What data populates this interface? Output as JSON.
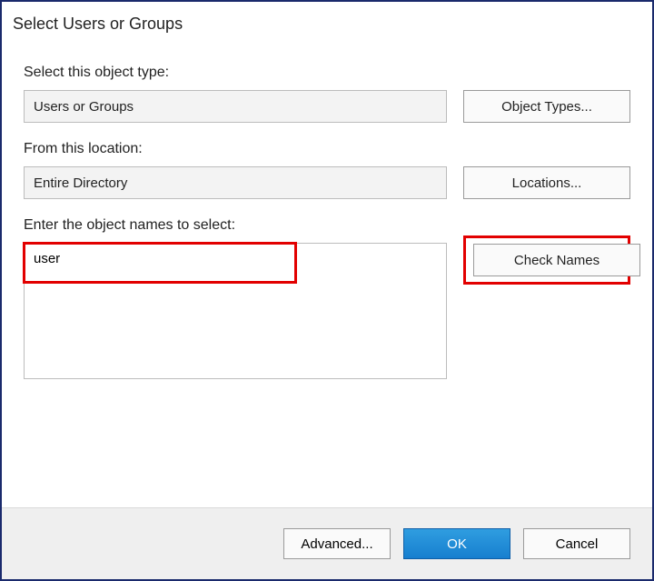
{
  "title": "Select Users or Groups",
  "objectType": {
    "label": "Select this object type:",
    "value": "Users or Groups",
    "button": "Object Types..."
  },
  "location": {
    "label": "From this location:",
    "value": "Entire Directory",
    "button": "Locations..."
  },
  "objectNames": {
    "label": "Enter the object names to select:",
    "value": "user",
    "button": "Check Names"
  },
  "footer": {
    "advanced": "Advanced...",
    "ok": "OK",
    "cancel": "Cancel"
  }
}
